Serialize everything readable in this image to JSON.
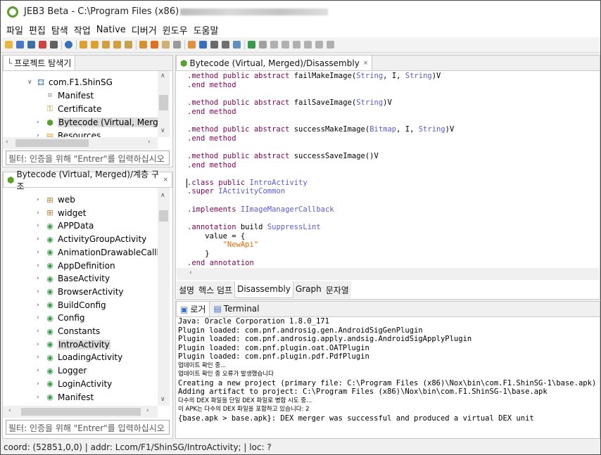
{
  "window": {
    "app_title": "JEB3 Beta - C:\\Program Files (x86)"
  },
  "menu": [
    "파일",
    "편집",
    "탐색",
    "작업",
    "Native",
    "디버거",
    "윈도우",
    "도움말"
  ],
  "colors": {
    "accent_green": "#5aa02c",
    "keyword": "#7f0055",
    "type": "#5a5ad6",
    "string": "#e06a00"
  },
  "project_explorer": {
    "tab_label": "프로젝트 탐색기",
    "tree": [
      {
        "label": "com.F1.ShinSG",
        "icon": "android-package-icon",
        "glyph": "⚃"
      },
      {
        "label": "Manifest",
        "icon": "manifest-icon",
        "glyph": "⌗"
      },
      {
        "label": "Certificate",
        "icon": "certificate-icon",
        "glyph": "⚿"
      },
      {
        "label": "Bytecode (Virtual, Merged)",
        "icon": "bytecode-icon",
        "glyph": "⬢"
      },
      {
        "label": "Resources",
        "icon": "folder-icon",
        "glyph": "▤"
      }
    ],
    "filter_placeholder": "필터: 인증을 위해 \"Entrer\"를 입력하십시오"
  },
  "hierarchy": {
    "tab_label": "Bytecode (Virtual, Merged)/계층 구조",
    "tree": [
      {
        "label": "web",
        "icon": "package-icon",
        "glyph": "⊞"
      },
      {
        "label": "widget",
        "icon": "package-icon",
        "glyph": "⊞"
      },
      {
        "label": "APPData",
        "icon": "class-icon",
        "glyph": "◉"
      },
      {
        "label": "ActivityGroupActivity",
        "icon": "class-icon",
        "glyph": "◉"
      },
      {
        "label": "AnimationDrawableCallbac",
        "icon": "class-icon",
        "glyph": "◉"
      },
      {
        "label": "AppDefinition",
        "icon": "class-icon",
        "glyph": "◉"
      },
      {
        "label": "BaseActivity",
        "icon": "class-icon",
        "glyph": "◉"
      },
      {
        "label": "BrowserActivity",
        "icon": "class-icon",
        "glyph": "◉"
      },
      {
        "label": "BuildConfig",
        "icon": "class-icon",
        "glyph": "◉"
      },
      {
        "label": "Config",
        "icon": "class-icon",
        "glyph": "◉"
      },
      {
        "label": "Constants",
        "icon": "class-icon",
        "glyph": "◉"
      },
      {
        "label": "IntroActivity",
        "icon": "class-icon",
        "glyph": "◉"
      },
      {
        "label": "LoadingActivity",
        "icon": "class-icon",
        "glyph": "◉"
      },
      {
        "label": "Logger",
        "icon": "class-icon",
        "glyph": "◉"
      },
      {
        "label": "LoginActivity",
        "icon": "class-icon",
        "glyph": "◉"
      },
      {
        "label": "Manifest",
        "icon": "class-icon",
        "glyph": "◉"
      }
    ],
    "filter_placeholder": "필터: 인증을 위해 \"Entrer\"를 입력하십시오"
  },
  "editor": {
    "tab_label": "Bytecode (Virtual, Merged)/Disassembly",
    "code_lines": [
      [
        [
          ".method public abstract ",
          "kw"
        ],
        [
          "failMakeImage(",
          "bk"
        ],
        [
          "String",
          "ty"
        ],
        [
          ", I, ",
          "bk"
        ],
        [
          "String",
          "ty"
        ],
        [
          ")V",
          "bk"
        ]
      ],
      [
        [
          ".end method",
          "kw"
        ]
      ],
      [
        [
          "",
          "bk"
        ]
      ],
      [
        [
          ".method public abstract ",
          "kw"
        ],
        [
          "failSaveImage(",
          "bk"
        ],
        [
          "String",
          "ty"
        ],
        [
          ")V",
          "bk"
        ]
      ],
      [
        [
          ".end method",
          "kw"
        ]
      ],
      [
        [
          "",
          "bk"
        ]
      ],
      [
        [
          ".method public abstract ",
          "kw"
        ],
        [
          "successMakeImage(",
          "bk"
        ],
        [
          "Bitmap",
          "ty"
        ],
        [
          ", I, ",
          "bk"
        ],
        [
          "String",
          "ty"
        ],
        [
          ")V",
          "bk"
        ]
      ],
      [
        [
          ".end method",
          "kw"
        ]
      ],
      [
        [
          "",
          "bk"
        ]
      ],
      [
        [
          ".method public abstract ",
          "kw"
        ],
        [
          "successSaveImage()V",
          "bk"
        ]
      ],
      [
        [
          ".end method",
          "kw"
        ]
      ],
      [
        [
          "",
          "bk"
        ]
      ],
      [
        [
          ".class public ",
          "kw"
        ],
        [
          "IntroActivity",
          "ty"
        ]
      ],
      [
        [
          ".super ",
          "kw"
        ],
        [
          "IActivityCommon",
          "ty"
        ]
      ],
      [
        [
          "",
          "bk"
        ]
      ],
      [
        [
          ".implements ",
          "kw"
        ],
        [
          "IImageManagerCallback",
          "ty"
        ]
      ],
      [
        [
          "",
          "bk"
        ]
      ],
      [
        [
          ".annotation ",
          "kw"
        ],
        [
          "build ",
          "bk"
        ],
        [
          "SuppressLint",
          "ty"
        ]
      ],
      [
        [
          "    value = {",
          "bk"
        ]
      ],
      [
        [
          "        \"NewApi\"",
          "st"
        ]
      ],
      [
        [
          "    }",
          "bk"
        ]
      ],
      [
        [
          ".end annotation",
          "kw"
        ]
      ]
    ],
    "sub_tabs": [
      "설명",
      "헥스 덤프",
      "Disassembly",
      "Graph",
      "문자열"
    ],
    "active_sub_tab": "Disassembly"
  },
  "console": {
    "tabs": [
      "로거",
      "Terminal"
    ],
    "lines": [
      "Java: Oracle Corporation 1.8.0_171",
      "Plugin loaded: com.pnf.androsig.gen.AndroidSigGenPlugin",
      "Plugin loaded: com.pnf.androsig.apply.andsig.AndroidSigApplyPlugin",
      "Plugin loaded: com.pnf.plugin.oat.OATPlugin",
      "Plugin loaded: com.pnf.plugin.pdf.PdfPlugin",
      "업데이트 확인 중...",
      "업데이트 확인 중 오류가 발생했습니다",
      "Creating a new project (primary file: C:\\Program Files (x86)\\Nox\\bin\\com.F1.ShinSG-1\\base.apk)",
      "Adding artifact to project: C:\\Program Files (x86)\\Nox\\bin\\com.F1.ShinSG-1\\base.apk",
      "다수의 DEX 파일을 단일 DEX 파일로 병합 시도 중...",
      "이 APK는 다수의 DEX 파일을 포함하고 있습니다: 2",
      "{base.apk > base.apk}: DEX merger was successful and produced a virtual DEX unit"
    ]
  },
  "status_bar": "coord: (52851,0,0) | addr: Lcom/F1/ShinSG/IntroActivity; | loc: ?"
}
